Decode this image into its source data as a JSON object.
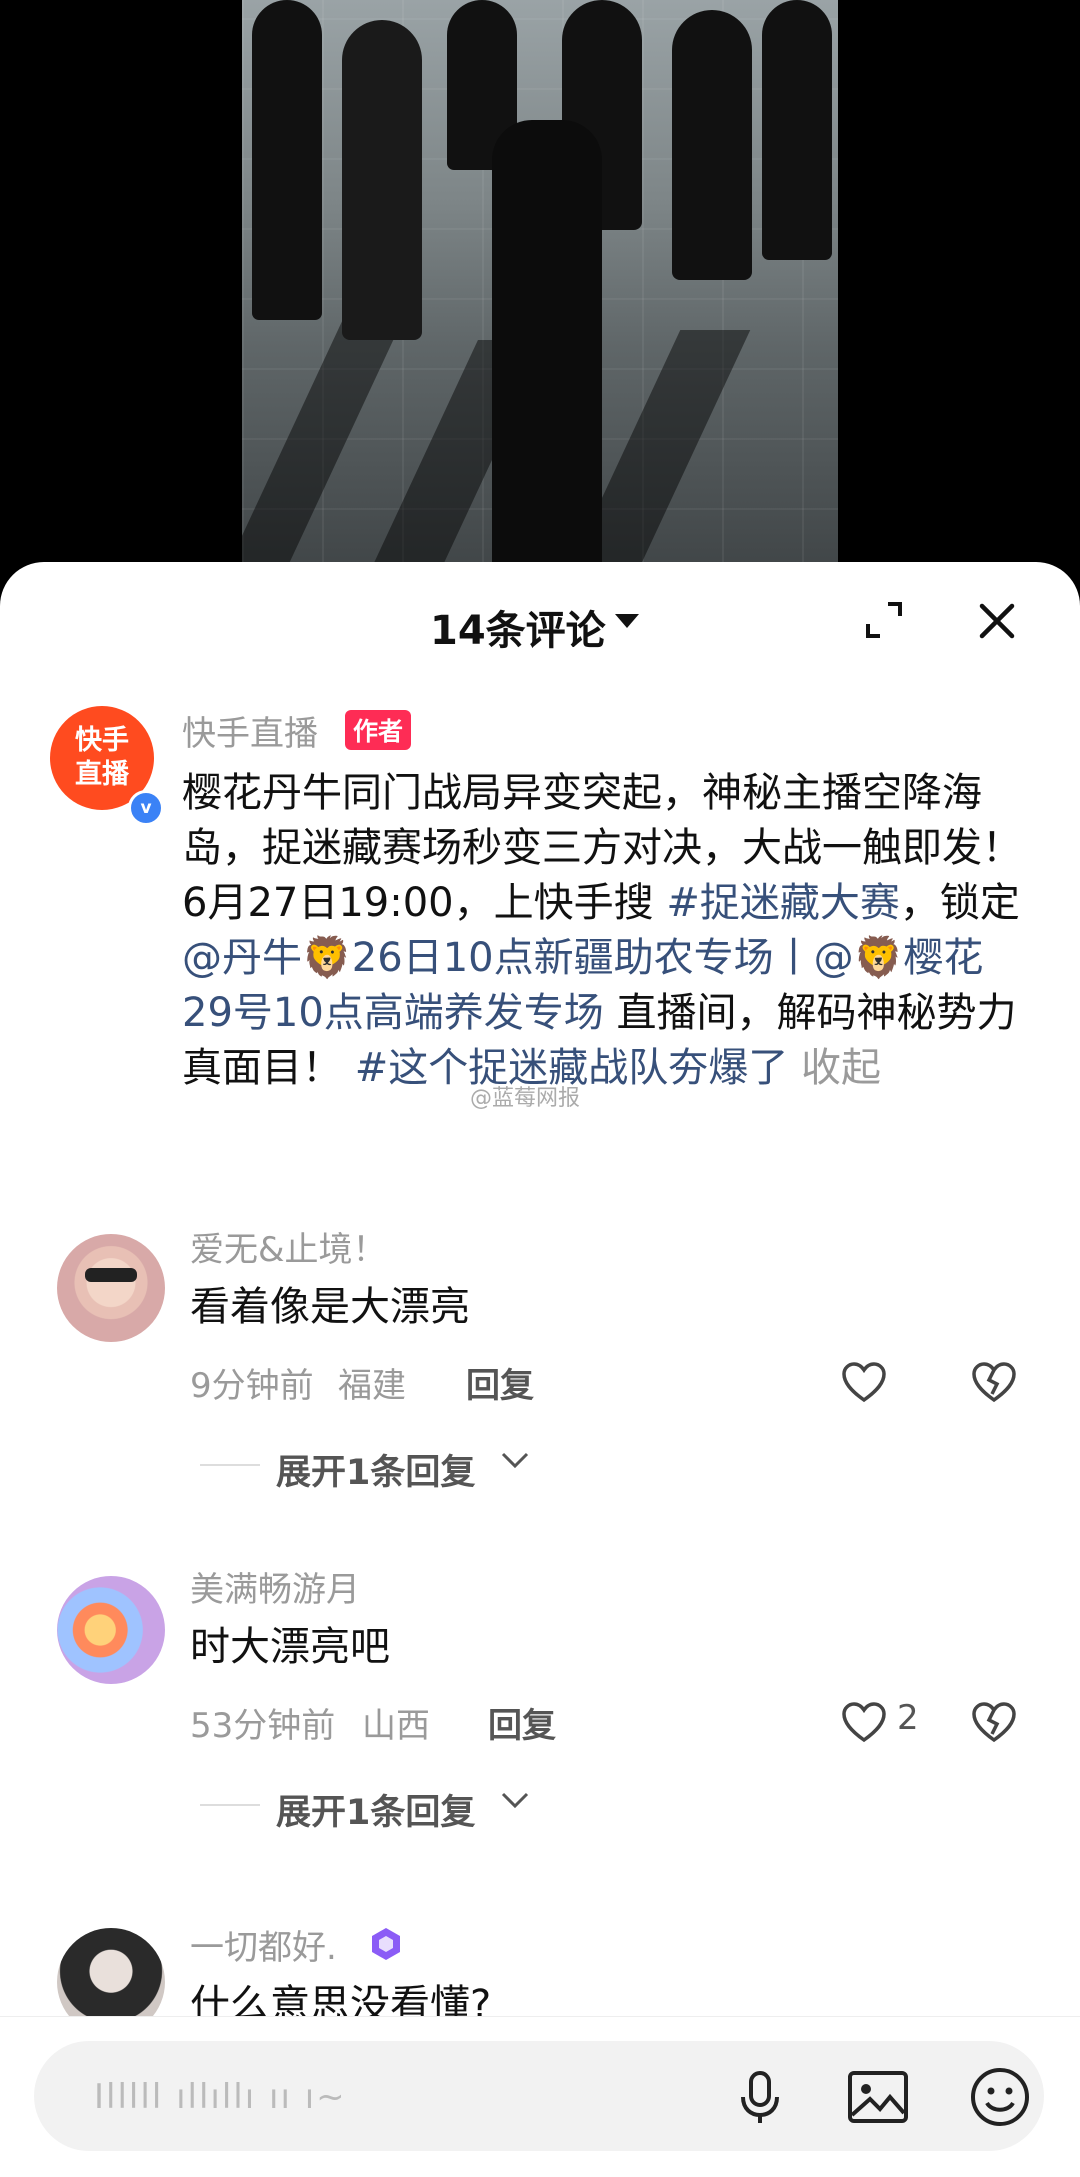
{
  "header": {
    "title": "14条评论"
  },
  "author": {
    "avatar_line1": "快手",
    "avatar_line2": "直播",
    "name": "快手直播",
    "tag": "作者",
    "text_1": "樱花丹牛同门战局异变突起，神秘主播空降海岛，捉迷藏赛场秒变三方对决，大战一触即发！6月27日19:00，上快手搜 ",
    "hashtag_1": "#捉迷藏大赛",
    "text_2": "，锁定",
    "mention_1": "@丹牛🦁26日10点新疆助农专场丨@🦁樱花29号10点高端养发专场",
    "text_3": " 直播间，解码神秘势力真面目！ ",
    "hashtag_2": "#这个捉迷藏战队夯爆了",
    "fold": " 收起"
  },
  "watermark": "@蓝莓网报",
  "comments": [
    {
      "name": "爱无&止境！",
      "text": "看着像是大漂亮",
      "time": "9分钟前",
      "location": "福建",
      "reply_label": "回复",
      "likes": "",
      "expand_label": "展开1条回复"
    },
    {
      "name": "美满畅游月",
      "text": "时大漂亮吧",
      "time": "53分钟前",
      "location": "山西",
      "reply_label": "回复",
      "likes": "2",
      "expand_label": "展开1条回复"
    },
    {
      "name": "一切都好.",
      "text": "什么意思没看懂?"
    }
  ],
  "input": {
    "placeholder": "Illlll ıllıllı ıı ı~"
  },
  "colors": {
    "brand": "#ff4b1f",
    "author_tag": "#fe2c55",
    "link": "#37507a",
    "verify": "#3b82f6"
  }
}
